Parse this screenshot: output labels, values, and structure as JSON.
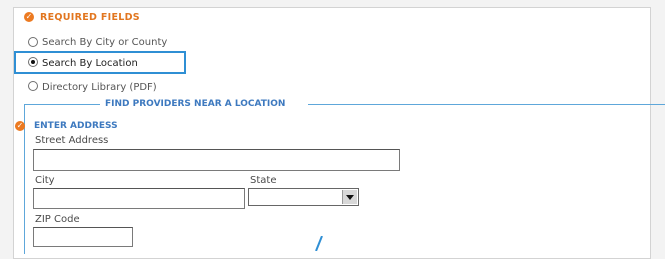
{
  "form": {
    "required_fields_label": "REQUIRED FIELDS",
    "search_options": [
      {
        "label": "Search By City or County",
        "selected": false
      },
      {
        "label": "Search By Location",
        "selected": true
      },
      {
        "label": "Directory Library (PDF)",
        "selected": false
      }
    ],
    "section_legend": "FIND PROVIDERS NEAR A LOCATION",
    "enter_address_label": "ENTER ADDRESS",
    "street_label": "Street Address",
    "street_value": "",
    "city_label": "City",
    "city_value": "",
    "state_label": "State",
    "state_value": "",
    "zip_label": "ZIP Code",
    "zip_value": ""
  },
  "colors": {
    "required_accent": "#ec7a21",
    "highlight_border": "#2f8fd4",
    "section_blue": "#3d79bf"
  },
  "icons": {
    "required_marker": "orange-circle-check-icon"
  }
}
